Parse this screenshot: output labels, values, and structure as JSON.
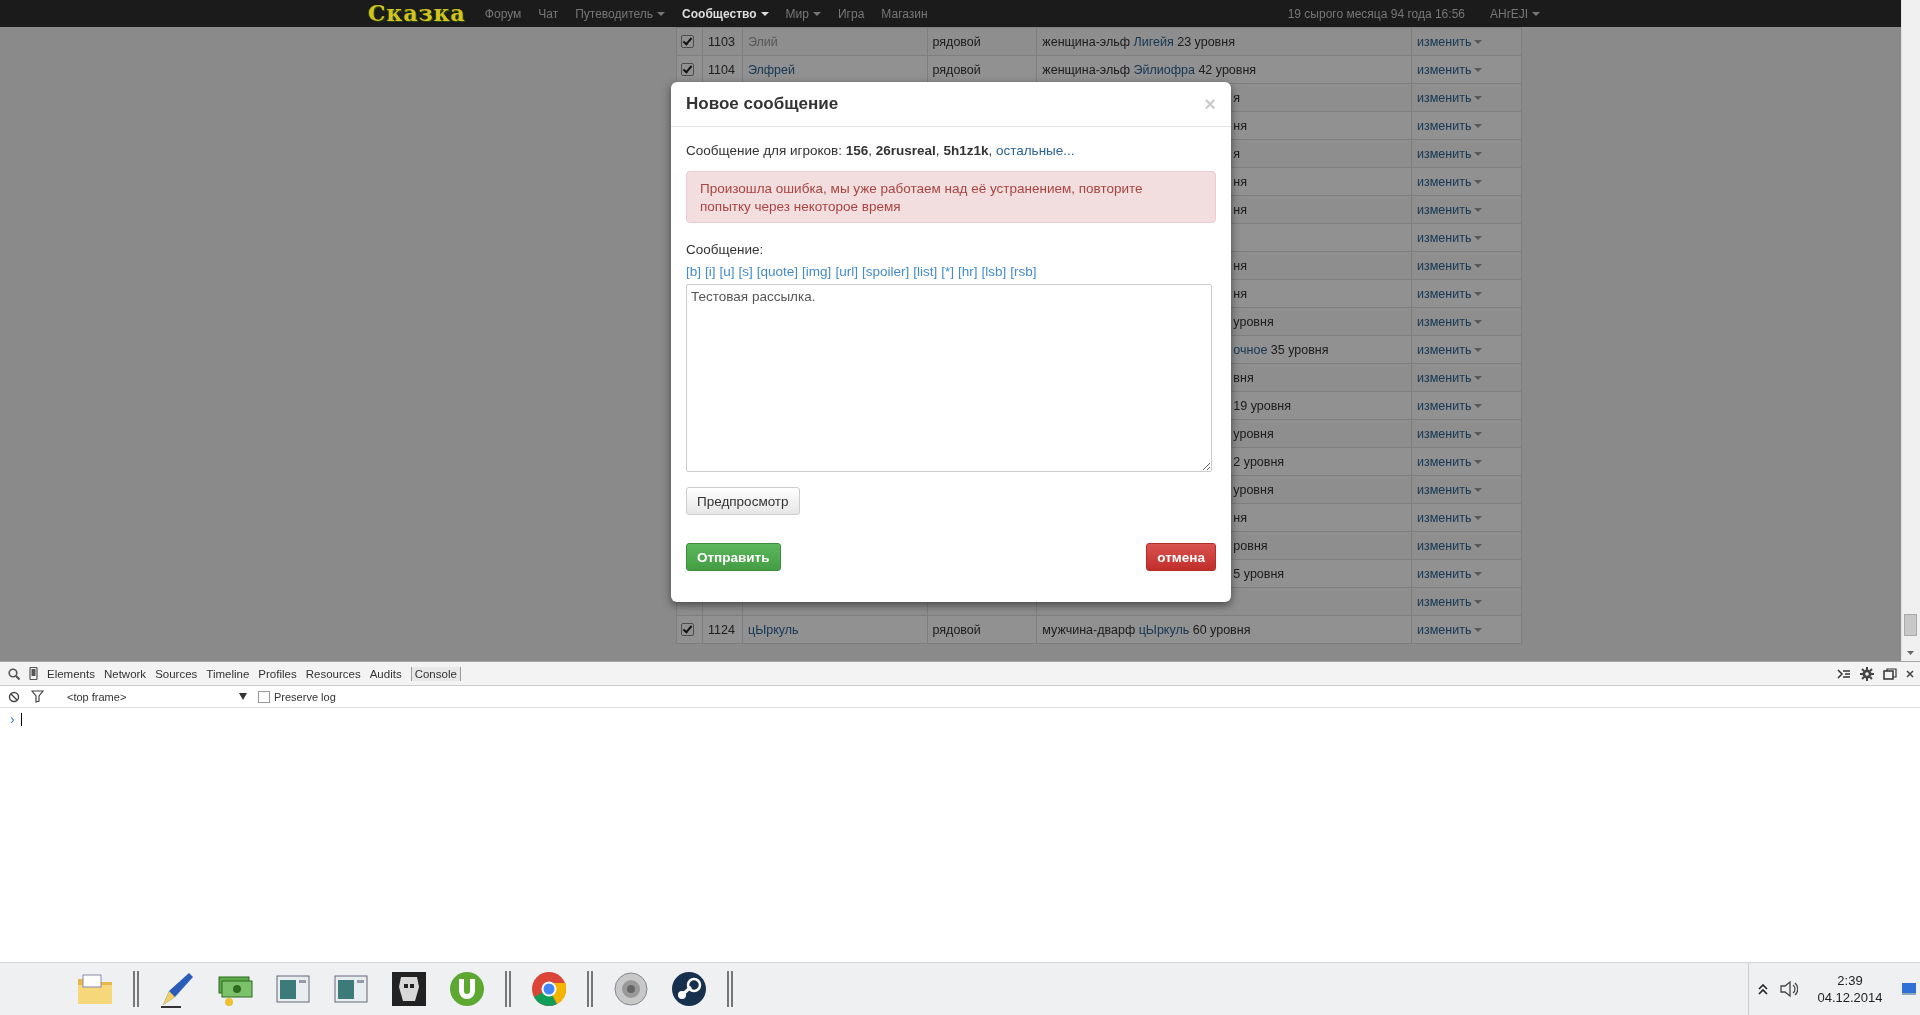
{
  "navbar": {
    "logo": "Сказка",
    "items": [
      {
        "label": "Форум",
        "dropdown": false,
        "selected": false
      },
      {
        "label": "Чат",
        "dropdown": false,
        "selected": false
      },
      {
        "label": "Путеводитель",
        "dropdown": true,
        "selected": false
      },
      {
        "label": "Сообщество",
        "dropdown": true,
        "selected": true
      },
      {
        "label": "Мир",
        "dropdown": true,
        "selected": false
      },
      {
        "label": "Игра",
        "dropdown": false,
        "selected": false
      },
      {
        "label": "Магазин",
        "dropdown": false,
        "selected": false
      }
    ],
    "date": "19 сырого месяца 94 года 16:56",
    "user": {
      "label": "AHrEJI",
      "dropdown": true
    }
  },
  "table": {
    "rows": [
      {
        "kind": "full",
        "checked": true,
        "id": "1103",
        "name": "Элий",
        "muted": true,
        "rank": "рядовой",
        "race": "женщина-эльф",
        "hero": "Лигейя",
        "level": "23 уровня",
        "action": "изменить"
      },
      {
        "kind": "full",
        "checked": true,
        "id": "1104",
        "name": "Элфрей",
        "muted": false,
        "rank": "рядовой",
        "race": "женщина-эльф",
        "hero": "Эйлиофра",
        "level": "42 уровня",
        "action": "изменить"
      },
      {
        "kind": "covered",
        "level": "я",
        "action": "изменить"
      },
      {
        "kind": "covered",
        "level": "ня",
        "action": "изменить"
      },
      {
        "kind": "covered",
        "level": "я",
        "action": "изменить"
      },
      {
        "kind": "covered",
        "level": "ня",
        "action": "изменить"
      },
      {
        "kind": "covered",
        "level": "ня",
        "action": "изменить"
      },
      {
        "kind": "covered",
        "action": "изменить"
      },
      {
        "kind": "covered",
        "level": "ня",
        "action": "изменить"
      },
      {
        "kind": "covered",
        "level": "ня",
        "action": "изменить"
      },
      {
        "kind": "covered",
        "level": "уровня",
        "action": "изменить"
      },
      {
        "kind": "covered",
        "hero": "очное",
        "level": "35 уровня",
        "action": "изменить"
      },
      {
        "kind": "covered",
        "level": "вня",
        "action": "изменить"
      },
      {
        "kind": "covered",
        "level": "19 уровня",
        "action": "изменить"
      },
      {
        "kind": "covered",
        "level": "уровня",
        "action": "изменить"
      },
      {
        "kind": "covered",
        "level": "2 уровня",
        "action": "изменить"
      },
      {
        "kind": "covered",
        "level": "уровня",
        "action": "изменить"
      },
      {
        "kind": "covered",
        "level": "ня",
        "action": "изменить"
      },
      {
        "kind": "covered",
        "level": "ровня",
        "action": "изменить"
      },
      {
        "kind": "covered",
        "level": "5 уровня",
        "action": "изменить"
      },
      {
        "kind": "covered",
        "action": "изменить"
      },
      {
        "kind": "full",
        "checked": true,
        "id": "1124",
        "name": "цЫркуль",
        "muted": false,
        "rank": "рядовой",
        "race": "мужчина-дварф",
        "hero": "цЫркуль",
        "level": "60 уровня",
        "action": "изменить"
      }
    ]
  },
  "modal": {
    "title": "Новое сообщение",
    "close": "×",
    "recipients": "Сообщение для игроков: **156**, **26rusreal**, **5h1z1k**,",
    "more_link": "остальные...",
    "alert": "Произошла ошибка, мы уже работаем над её устранением, повторите попытку через некоторое время",
    "message_label": "Сообщение:",
    "bbcodes": [
      "[b]",
      "[i]",
      "[u]",
      "[s]",
      "[quote]",
      "[img]",
      "[url]",
      "[spoiler]",
      "[list]",
      "[*]",
      "[hr]",
      "[lsb]",
      "[rsb]"
    ],
    "message": "Тестовая рассылка.",
    "preview_button": "Предпросмотр",
    "submit_button": "Отправить",
    "cancel_button": "отмена"
  },
  "devtools": {
    "tabs": [
      {
        "label": "Elements",
        "selected": false
      },
      {
        "label": "Network",
        "selected": false
      },
      {
        "label": "Sources",
        "selected": false
      },
      {
        "label": "Timeline",
        "selected": false
      },
      {
        "label": "Profiles",
        "selected": false
      },
      {
        "label": "Resources",
        "selected": false
      },
      {
        "label": "Audits",
        "selected": false
      },
      {
        "label": "Console",
        "selected": true
      }
    ],
    "frame_select": "<top frame>",
    "preserve_log": {
      "label": "Preserve log",
      "checked": false
    },
    "prompt": "›"
  },
  "taskbar": {
    "time": "2:39",
    "date": "04.12.2014"
  }
}
